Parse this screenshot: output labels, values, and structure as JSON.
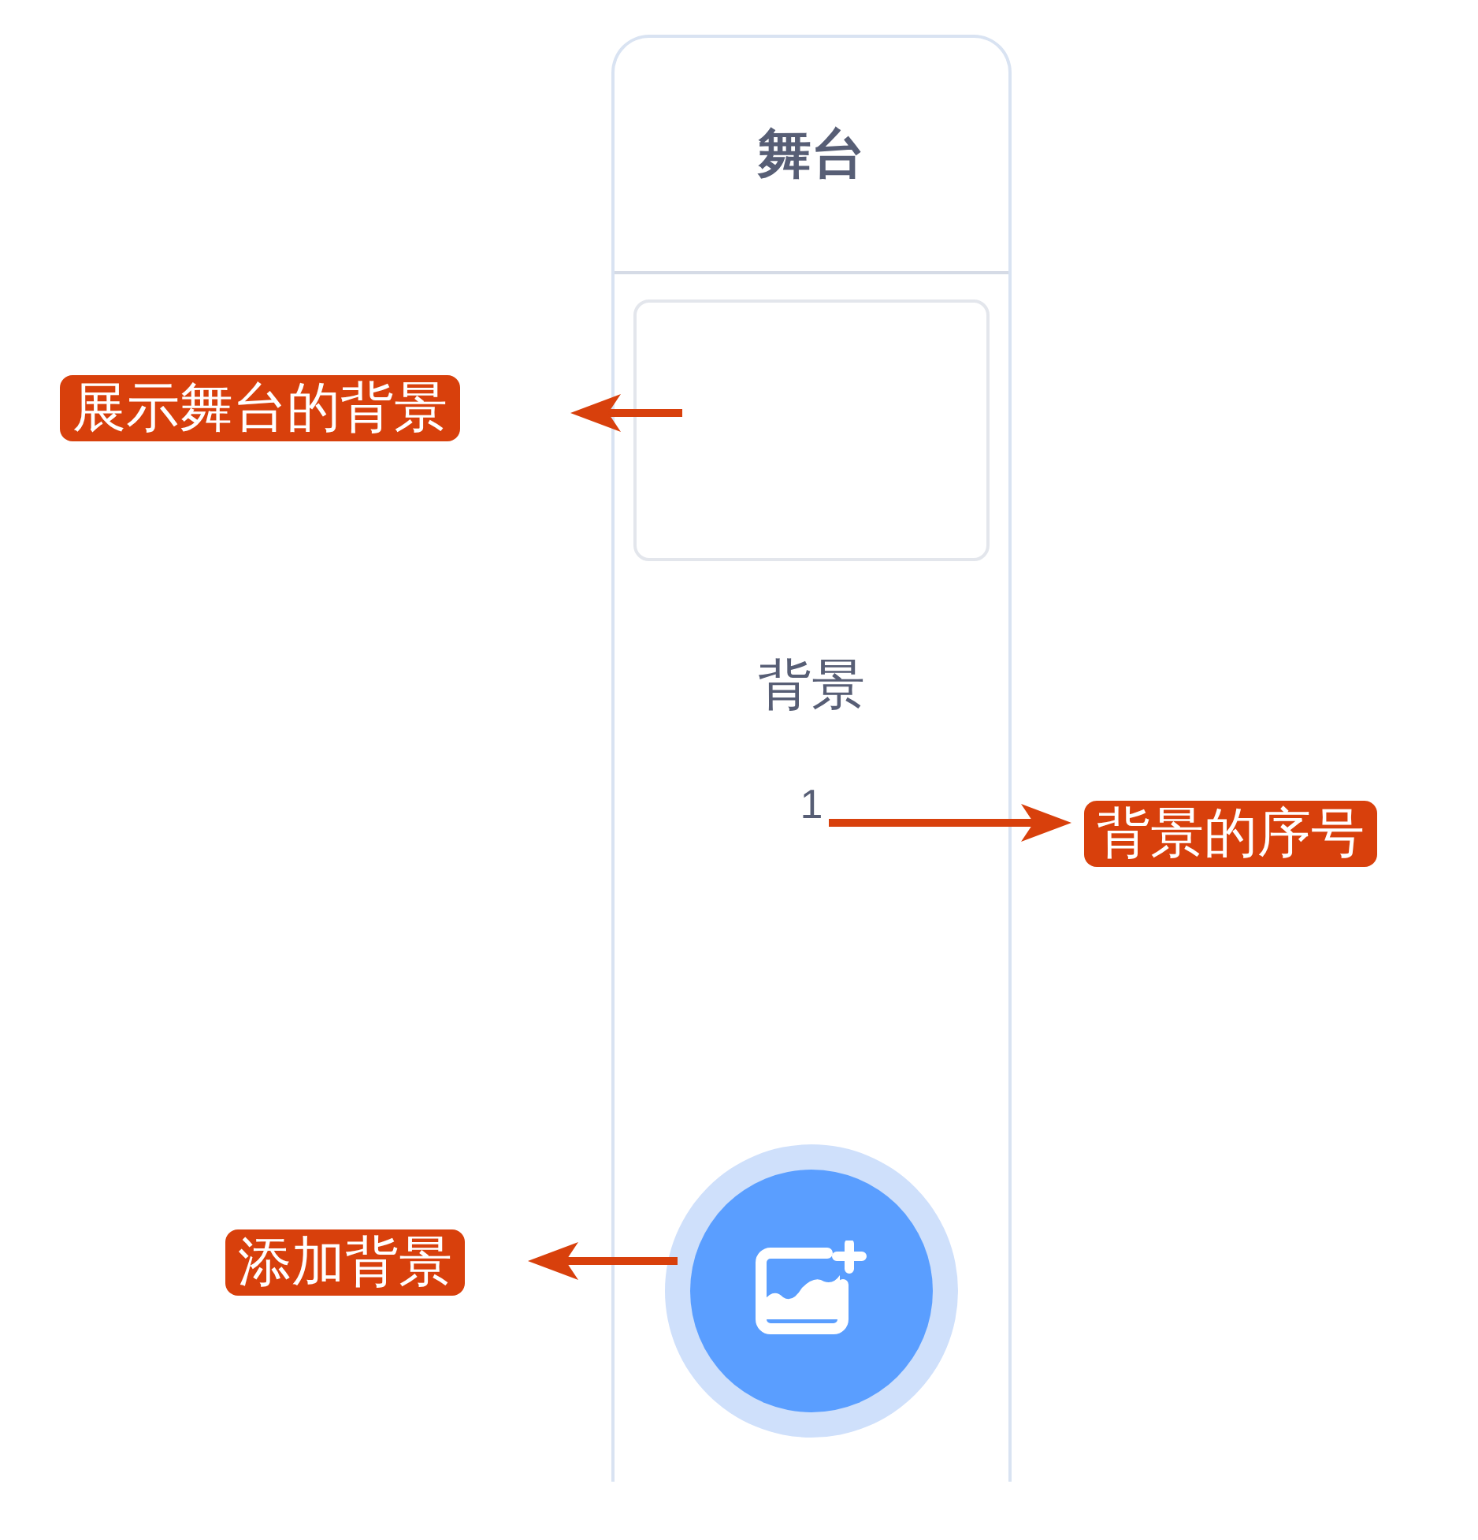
{
  "stage_panel": {
    "title": "舞台",
    "backdrop_label": "背景",
    "backdrop_number": "1"
  },
  "annotations": [
    {
      "text": "展示舞台的背景",
      "kind": "left"
    },
    {
      "text": "背景的序号",
      "kind": "right"
    },
    {
      "text": "添加背景",
      "kind": "left"
    }
  ]
}
